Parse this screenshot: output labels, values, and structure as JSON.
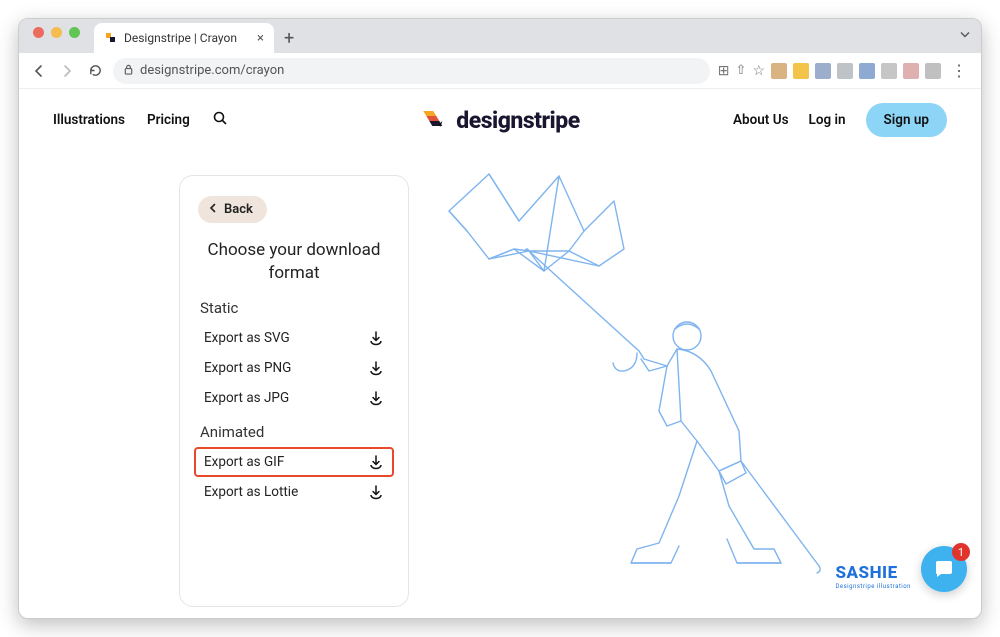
{
  "browser": {
    "tab_title": "Designstripe | Crayon",
    "url": "designstripe.com/crayon"
  },
  "nav": {
    "illustrations": "Illustrations",
    "pricing": "Pricing",
    "brand": "designstripe",
    "about": "About Us",
    "login": "Log in",
    "signup": "Sign up"
  },
  "panel": {
    "back": "Back",
    "title": "Choose your download format",
    "static_label": "Static",
    "animated_label": "Animated",
    "static": [
      {
        "label": "Export as SVG"
      },
      {
        "label": "Export as PNG"
      },
      {
        "label": "Export as JPG"
      }
    ],
    "animated": [
      {
        "label": "Export as GIF",
        "highlight": true
      },
      {
        "label": "Export as Lottie"
      }
    ]
  },
  "sashie": {
    "title": "SASHIE",
    "tagline": "Designstripe illustration"
  },
  "chat": {
    "badge": "1"
  }
}
